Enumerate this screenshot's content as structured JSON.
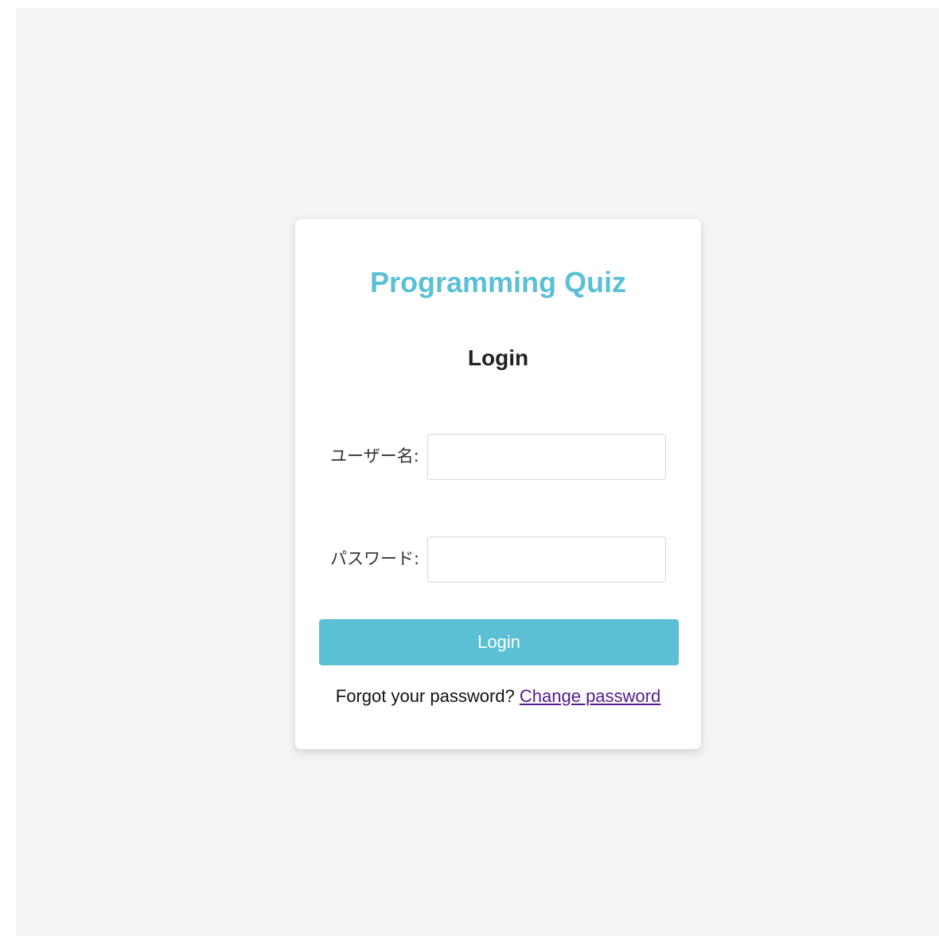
{
  "app": {
    "title": "Programming Quiz"
  },
  "login": {
    "heading": "Login",
    "username_label": "ユーザー名:",
    "username_value": "",
    "password_label": "パスワード:",
    "password_value": "",
    "submit_label": "Login"
  },
  "footer": {
    "forgot_text": "Forgot your password?",
    "change_link": "Change password"
  },
  "colors": {
    "accent": "#5bc0d6",
    "link": "#551a8b",
    "background": "#f4f4f4"
  }
}
